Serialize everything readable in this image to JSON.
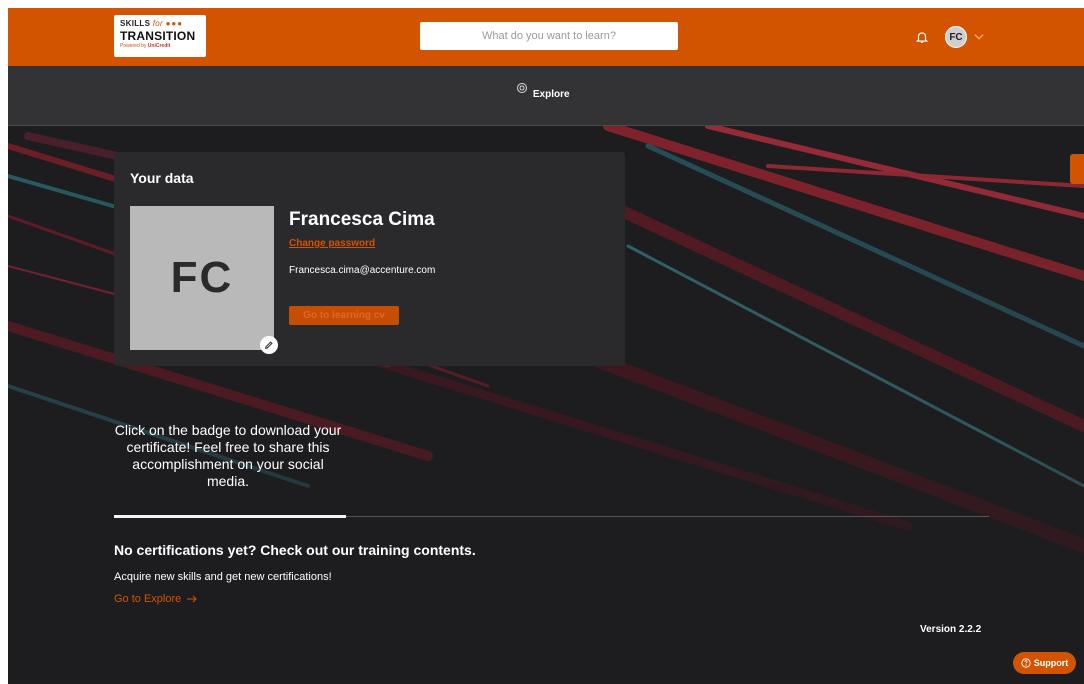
{
  "header": {
    "logo": {
      "line1_a": "SKILLS",
      "line1_b": "for",
      "line1_dots": "●●●",
      "line2": "TRANSITION",
      "line3_a": "Powered by",
      "line3_b": "UniCredit"
    },
    "search_placeholder": "What do you want to learn?",
    "user_initials": "FC"
  },
  "nav": {
    "explore_label": "Explore"
  },
  "profile": {
    "card_title": "Your data",
    "avatar_initials": "FC",
    "name": "Francesca Cima",
    "change_password": "Change password",
    "email": "Francesca.cima@accenture.com",
    "learning_cv_button": "Go to learning cv"
  },
  "certificates": {
    "badge_message": "Click on the badge to download your certificate! Feel free to share this accomplishment on your social media.",
    "empty_title": "No certifications yet? Check out our training contents.",
    "empty_subtitle": "Acquire new skills and get new certifications!",
    "explore_link": "Go to Explore"
  },
  "footer": {
    "version": "Version 2.2.2",
    "support_label": "Support"
  },
  "colors": {
    "accent": "#d35400",
    "header_bg": "#d35400",
    "nav_bg": "#333335",
    "card_bg": "#2a2a2c",
    "page_bg": "#1d1d20"
  }
}
